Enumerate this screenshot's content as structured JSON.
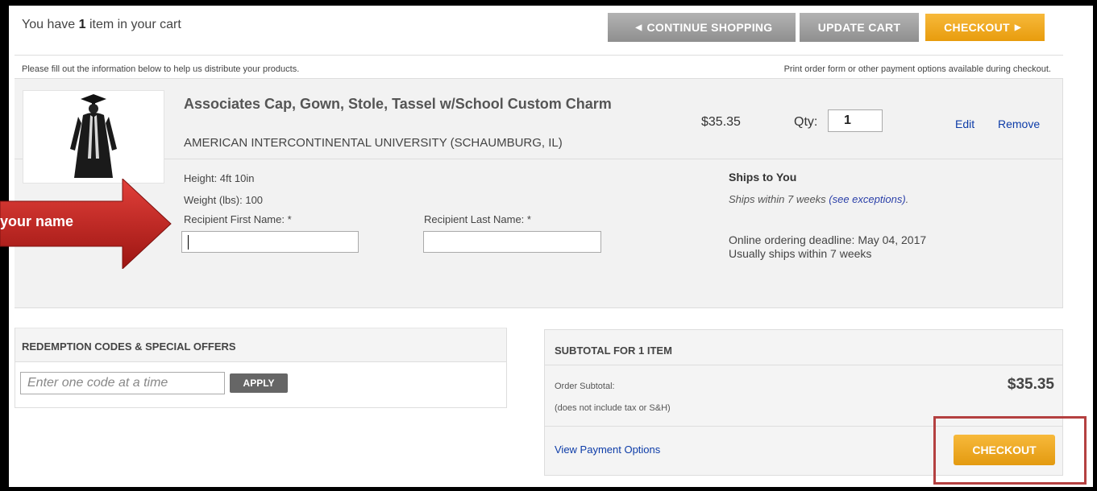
{
  "cart": {
    "title_prefix": "You have ",
    "count": "1",
    "title_suffix": " item in your cart"
  },
  "toolbar": {
    "continue_label": "CONTINUE SHOPPING",
    "update_label": "UPDATE CART",
    "checkout_label": "CHECKOUT"
  },
  "info": {
    "left": "Please fill out the information below to help us distribute your products.",
    "right": "Print order form or other payment options available during checkout."
  },
  "item": {
    "title": "Associates Cap, Gown, Stole, Tassel w/School Custom Charm",
    "school": "AMERICAN INTERCONTINENTAL UNIVERSITY (SCHAUMBURG, IL)",
    "price": "$35.35",
    "qty_label": "Qty:",
    "qty_value": "1",
    "edit_label": "Edit",
    "remove_label": "Remove",
    "height": "Height: 4ft 10in",
    "weight": "Weight (lbs): 100",
    "first_name_label": "Recipient First Name: *",
    "last_name_label": "Recipient Last Name: *",
    "first_name_value": "",
    "last_name_value": ""
  },
  "shipping": {
    "title": "Ships to You",
    "within_prefix": "Ships within 7 weeks ",
    "exceptions_link": "(see exceptions)",
    "within_suffix": ".",
    "deadline": "Online ordering deadline: May 04, 2017",
    "usually": "Usually ships within 7 weeks"
  },
  "redemption": {
    "title": "REDEMPTION CODES & SPECIAL OFFERS",
    "placeholder": "Enter one code at a time",
    "apply_label": "APPLY"
  },
  "subtotal": {
    "title": "SUBTOTAL FOR 1 ITEM",
    "order_subtotal_label": "Order Subtotal:",
    "tax_note": "(does not include tax or S&H)",
    "amount": "$35.35",
    "view_payment_label": "View Payment Options",
    "checkout_label": "CHECKOUT"
  },
  "callout": {
    "text": "your name"
  },
  "colors": {
    "checkout_orange": "#f0a824",
    "link_blue": "#0d3ca8",
    "callout_red": "#c0201e",
    "highlight_red": "#b44040"
  }
}
